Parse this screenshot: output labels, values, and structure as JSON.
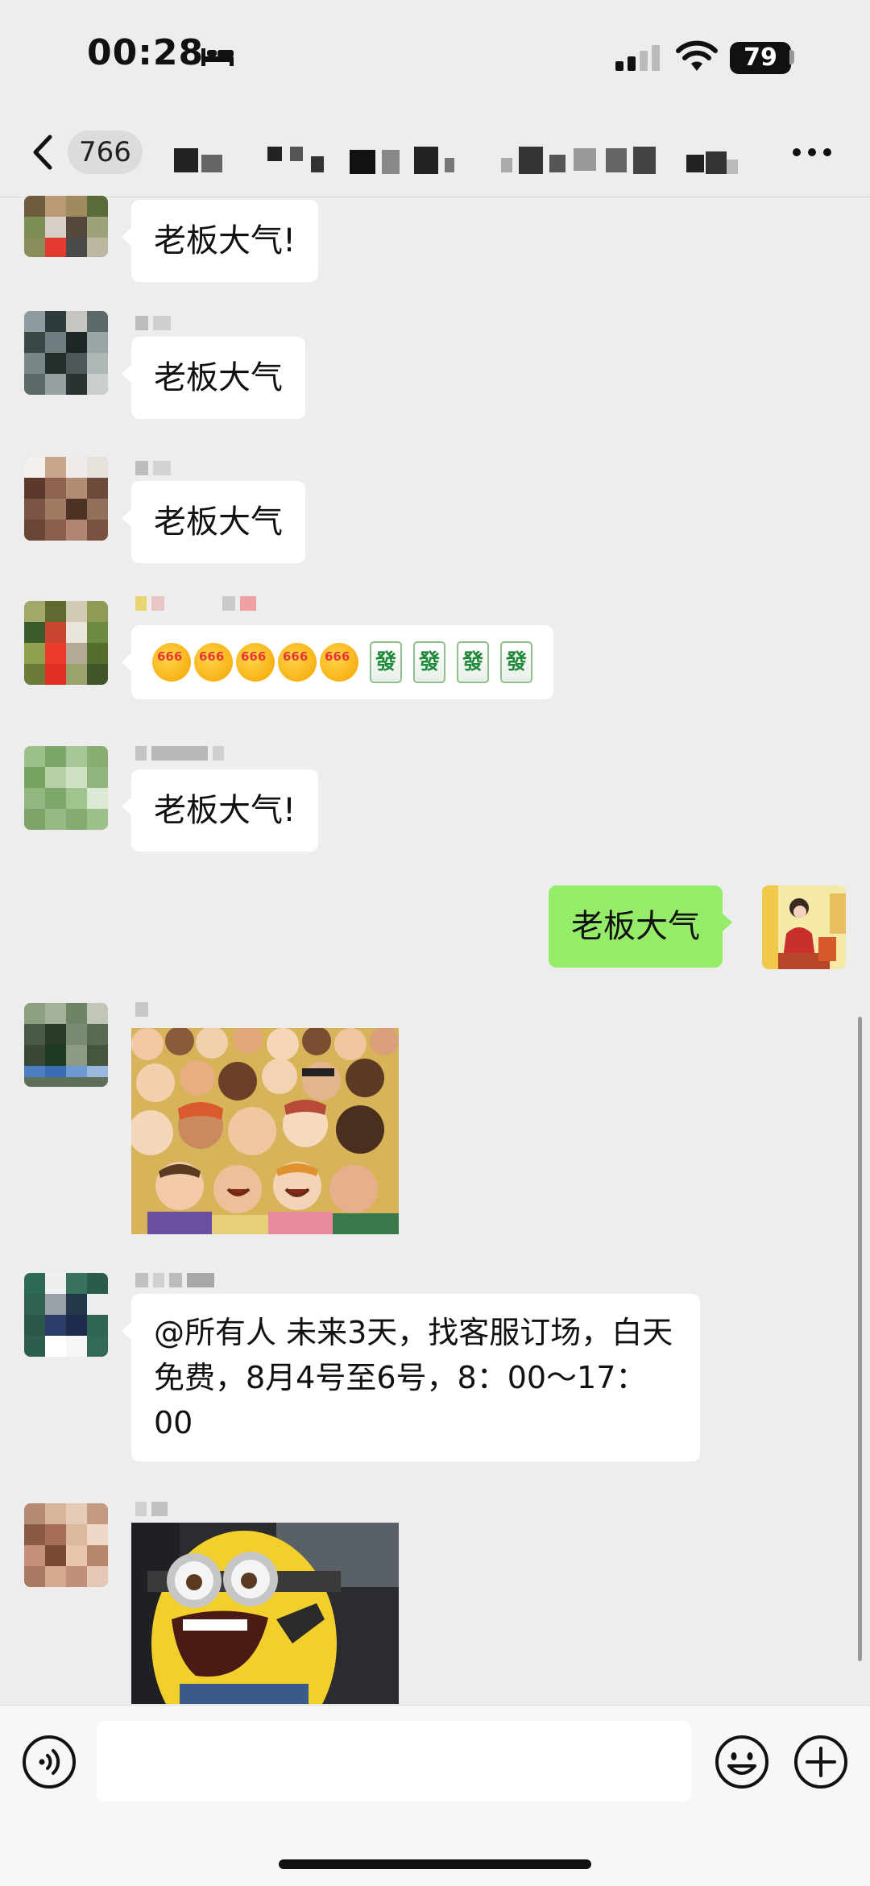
{
  "status_bar": {
    "time": "00:28",
    "battery": "79"
  },
  "header": {
    "unread_count": "766",
    "group_title": ""
  },
  "messages": [
    {
      "side": "left",
      "text": "老板大气!"
    },
    {
      "side": "left",
      "text": "老板大气"
    },
    {
      "side": "left",
      "text": "老板大气"
    },
    {
      "side": "left",
      "emoji_label": "666",
      "tile_char": "發"
    },
    {
      "side": "left",
      "text": "老板大气!"
    },
    {
      "side": "right",
      "text": "老板大气"
    },
    {
      "side": "left",
      "type": "image",
      "image": "cartoon-crowd-clapping"
    },
    {
      "side": "left",
      "text": "@所有人 未来3天，找客服订场，白天免费，8月4号至6号，8：00～17：00"
    },
    {
      "side": "left",
      "type": "image",
      "image": "minion-laughing"
    }
  ],
  "input": {
    "value": "",
    "placeholder": ""
  },
  "icons": {
    "back": "back-chevron-icon",
    "more": "more-dots-icon",
    "voice": "voice-icon",
    "emoji": "emoji-icon",
    "plus": "plus-icon"
  },
  "colors": {
    "background": "#ededed",
    "own_bubble": "#95ec69",
    "other_bubble": "#ffffff"
  }
}
